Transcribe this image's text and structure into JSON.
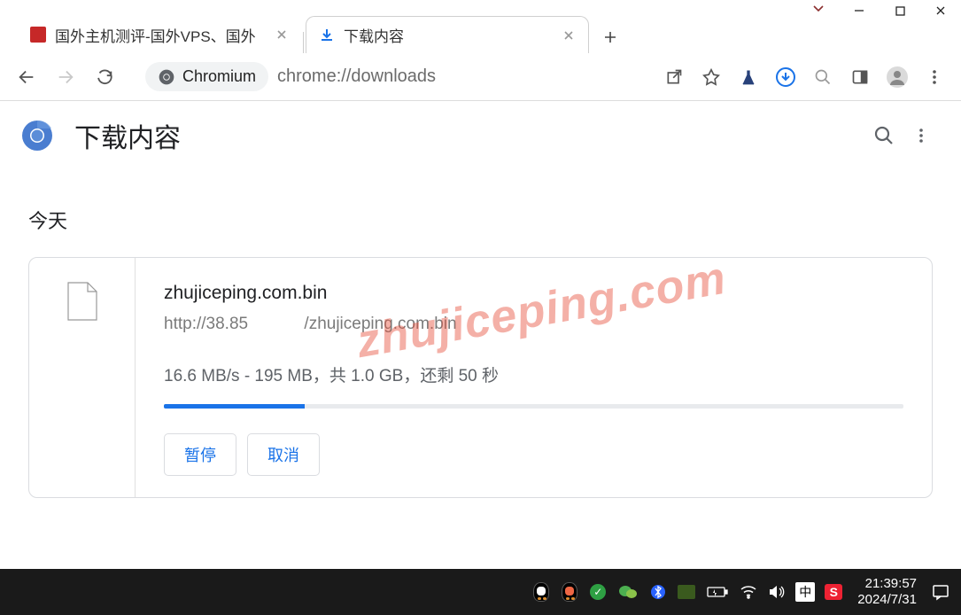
{
  "tabs": [
    {
      "title": "国外主机测评-国外VPS、国外"
    },
    {
      "title": "下载内容"
    }
  ],
  "omnibox": {
    "badge": "Chromium",
    "url": "chrome://downloads"
  },
  "downloads": {
    "page_title": "下载内容",
    "section_label": "今天",
    "item": {
      "filename": "zhujiceping.com.bin",
      "url": "http://38.85            /zhujiceping.com.bin",
      "progress_text": "16.6 MB/s - 195 MB，共 1.0 GB，还剩 50 秒",
      "progress_percent": 19,
      "pause_label": "暂停",
      "cancel_label": "取消"
    }
  },
  "watermark": "zhujiceping.com",
  "taskbar": {
    "ime": "中",
    "s_label": "S",
    "time": "21:39:57",
    "date": "2024/7/31"
  }
}
